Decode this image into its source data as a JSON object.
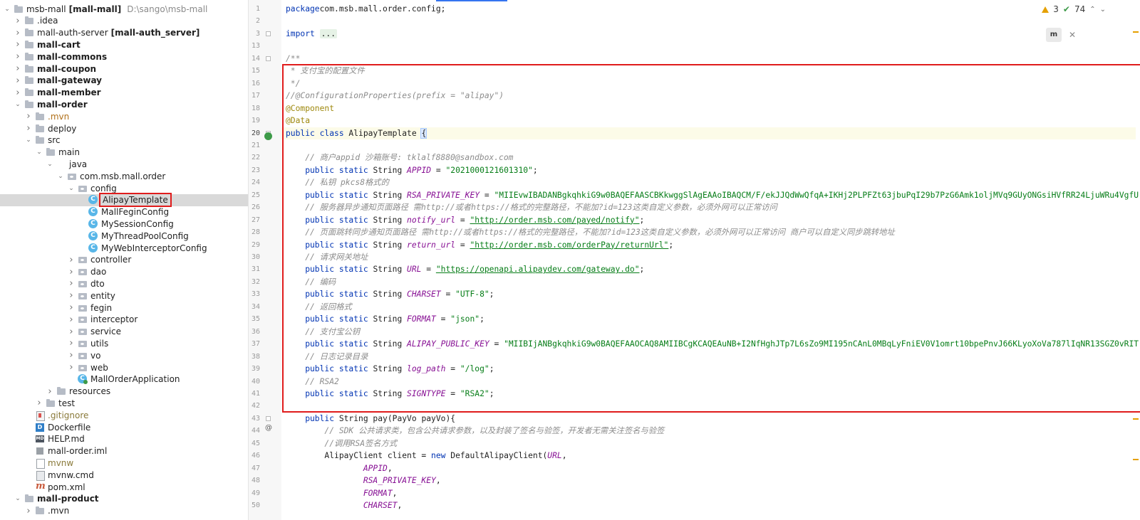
{
  "tree": {
    "rows": [
      {
        "label": "msb-mall",
        "extra": "[mall-mall]",
        "path": "D:\\sango\\msb-mall",
        "arrow": "down",
        "icon": "folder",
        "indent": 0,
        "bold": false
      },
      {
        "label": ".idea",
        "arrow": "right",
        "icon": "folder",
        "indent": 1
      },
      {
        "label": "mall-auth-server",
        "extra": "[mall-auth_server]",
        "arrow": "right",
        "icon": "folder",
        "indent": 1
      },
      {
        "label": "mall-cart",
        "arrow": "right",
        "icon": "folder",
        "indent": 1,
        "bold": true
      },
      {
        "label": "mall-commons",
        "arrow": "right",
        "icon": "folder",
        "indent": 1,
        "bold": true
      },
      {
        "label": "mall-coupon",
        "arrow": "right",
        "icon": "folder",
        "indent": 1,
        "bold": true
      },
      {
        "label": "mall-gateway",
        "arrow": "right",
        "icon": "folder",
        "indent": 1,
        "bold": true
      },
      {
        "label": "mall-member",
        "arrow": "right",
        "icon": "folder",
        "indent": 1,
        "bold": true
      },
      {
        "label": "mall-order",
        "arrow": "down",
        "icon": "folder",
        "indent": 1,
        "bold": true
      },
      {
        "label": ".mvn",
        "arrow": "right",
        "icon": "folder",
        "indent": 2,
        "style": "orange"
      },
      {
        "label": "deploy",
        "arrow": "right",
        "icon": "folder",
        "indent": 2
      },
      {
        "label": "src",
        "arrow": "down",
        "icon": "folder",
        "indent": 2
      },
      {
        "label": "main",
        "arrow": "down",
        "icon": "folder",
        "indent": 3
      },
      {
        "label": "java",
        "arrow": "down",
        "icon": "folder-blue",
        "indent": 4
      },
      {
        "label": "com.msb.mall.order",
        "arrow": "down",
        "icon": "pkg",
        "indent": 5
      },
      {
        "label": "config",
        "arrow": "down",
        "icon": "pkg",
        "indent": 6
      },
      {
        "label": "AlipayTemplate",
        "arrow": "none",
        "icon": "cls",
        "indent": 7,
        "selected": true,
        "boxed": true
      },
      {
        "label": "MallFeginConfig",
        "arrow": "none",
        "icon": "cls",
        "indent": 7
      },
      {
        "label": "MySessionConfig",
        "arrow": "none",
        "icon": "cls",
        "indent": 7
      },
      {
        "label": "MyThreadPoolConfig",
        "arrow": "none",
        "icon": "cls",
        "indent": 7
      },
      {
        "label": "MyWebInterceptorConfig",
        "arrow": "none",
        "icon": "cls",
        "indent": 7
      },
      {
        "label": "controller",
        "arrow": "right",
        "icon": "pkg",
        "indent": 6
      },
      {
        "label": "dao",
        "arrow": "right",
        "icon": "pkg",
        "indent": 6
      },
      {
        "label": "dto",
        "arrow": "right",
        "icon": "pkg",
        "indent": 6
      },
      {
        "label": "entity",
        "arrow": "right",
        "icon": "pkg",
        "indent": 6
      },
      {
        "label": "fegin",
        "arrow": "right",
        "icon": "pkg",
        "indent": 6
      },
      {
        "label": "interceptor",
        "arrow": "right",
        "icon": "pkg",
        "indent": 6
      },
      {
        "label": "service",
        "arrow": "right",
        "icon": "pkg",
        "indent": 6
      },
      {
        "label": "utils",
        "arrow": "right",
        "icon": "pkg",
        "indent": 6
      },
      {
        "label": "vo",
        "arrow": "right",
        "icon": "pkg",
        "indent": 6
      },
      {
        "label": "web",
        "arrow": "right",
        "icon": "pkg",
        "indent": 6
      },
      {
        "label": "MallOrderApplication",
        "arrow": "none",
        "icon": "app",
        "indent": 6
      },
      {
        "label": "resources",
        "arrow": "right",
        "icon": "folder",
        "indent": 4
      },
      {
        "label": "test",
        "arrow": "right",
        "icon": "folder",
        "indent": 3
      },
      {
        "label": ".gitignore",
        "arrow": "none",
        "icon": "git",
        "indent": 2,
        "style": "olive"
      },
      {
        "label": "Dockerfile",
        "arrow": "none",
        "icon": "docker",
        "indent": 2
      },
      {
        "label": "HELP.md",
        "arrow": "none",
        "icon": "md",
        "indent": 2
      },
      {
        "label": "mall-order.iml",
        "arrow": "none",
        "icon": "iml",
        "indent": 2
      },
      {
        "label": "mvnw",
        "arrow": "none",
        "icon": "sh",
        "indent": 2,
        "style": "olive"
      },
      {
        "label": "mvnw.cmd",
        "arrow": "none",
        "icon": "file",
        "indent": 2
      },
      {
        "label": "pom.xml",
        "arrow": "none",
        "icon": "maven",
        "indent": 2
      },
      {
        "label": "mall-product",
        "arrow": "down",
        "icon": "folder",
        "indent": 1,
        "bold": true
      },
      {
        "label": ".mvn",
        "arrow": "right",
        "icon": "folder",
        "indent": 2
      }
    ]
  },
  "editor": {
    "inspections": {
      "warnings": "3",
      "ok": "74"
    },
    "maven_popup": {
      "icon_label": "m"
    },
    "lines": [
      {
        "n": "1",
        "tokens": [
          [
            "kw",
            "package"
          ],
          [
            "",
            "com.msb.mall.order.config;"
          ]
        ]
      },
      {
        "n": "2",
        "tokens": []
      },
      {
        "n": "3",
        "tokens": [
          [
            "kw",
            "import "
          ],
          [
            "folded",
            "..."
          ]
        ]
      },
      {
        "n": "13",
        "tokens": []
      },
      {
        "n": "14",
        "tokens": [
          [
            "cm",
            "/**"
          ]
        ]
      },
      {
        "n": "15",
        "tokens": [
          [
            "cm",
            " * 支付宝的配置文件"
          ]
        ]
      },
      {
        "n": "16",
        "tokens": [
          [
            "cm",
            " */"
          ]
        ]
      },
      {
        "n": "17",
        "tokens": [
          [
            "cm",
            "//@ConfigurationProperties(prefix = \"alipay\")"
          ]
        ]
      },
      {
        "n": "18",
        "tokens": [
          [
            "ann",
            "@Component"
          ]
        ]
      },
      {
        "n": "19",
        "tokens": [
          [
            "ann",
            "@Data"
          ]
        ]
      },
      {
        "n": "20",
        "tokens": [
          [
            "kw",
            "public class "
          ],
          [
            "",
            "AlipayTemplate "
          ],
          [
            "brace",
            "{"
          ]
        ],
        "current": true
      },
      {
        "n": "21",
        "tokens": []
      },
      {
        "n": "22",
        "tokens": [
          [
            "cm",
            "    // 商户appid 沙箱账号: tklalf8880@sandbox.com"
          ]
        ]
      },
      {
        "n": "23",
        "tokens": [
          [
            "kw",
            "    public static "
          ],
          [
            "",
            "String "
          ],
          [
            "fld",
            "APPID"
          ],
          [
            "",
            " = "
          ],
          [
            "str",
            "\"2021000121601310\""
          ],
          [
            "",
            ";"
          ]
        ]
      },
      {
        "n": "24",
        "tokens": [
          [
            "cm",
            "    // 私钥 pkcs8格式的"
          ]
        ]
      },
      {
        "n": "25",
        "tokens": [
          [
            "kw",
            "    public static "
          ],
          [
            "",
            "String "
          ],
          [
            "fld",
            "RSA_PRIVATE_KEY"
          ],
          [
            "",
            " = "
          ],
          [
            "str",
            "\"MIIEvwIBADANBgkqhkiG9w0BAQEFAASCBKkwggSlAgEAAoIBAQCM/F/ekJJQdWwQfqA+IKHj2PLPFZt63jbuPqI29b7PzG6Amk1oljMVq9GUyONGsiHVfRR24LjuWRu4VgfU"
          ]
        ]
      },
      {
        "n": "26",
        "tokens": [
          [
            "cm",
            "    // 服务器异步通知页面路径 需http://或者https://格式的完整路径，不能加?id=123这类自定义参数，必须外网可以正常访问"
          ]
        ]
      },
      {
        "n": "27",
        "tokens": [
          [
            "kw",
            "    public static "
          ],
          [
            "",
            "String "
          ],
          [
            "fld",
            "notify_url"
          ],
          [
            "",
            " = "
          ],
          [
            "url",
            "\"http://order.msb.com/payed/notify\""
          ],
          [
            "",
            ";"
          ]
        ]
      },
      {
        "n": "28",
        "tokens": [
          [
            "cm",
            "    // 页面跳转同步通知页面路径 需http://或者https://格式的完整路径，不能加?id=123这类自定义参数，必须外网可以正常访问 商户可以自定义同步跳转地址"
          ]
        ]
      },
      {
        "n": "29",
        "tokens": [
          [
            "kw",
            "    public static "
          ],
          [
            "",
            "String "
          ],
          [
            "fld",
            "return_url"
          ],
          [
            "",
            " = "
          ],
          [
            "url",
            "\"http://order.msb.com/orderPay/returnUrl\""
          ],
          [
            "",
            ";"
          ]
        ]
      },
      {
        "n": "30",
        "tokens": [
          [
            "cm",
            "    // 请求网关地址"
          ]
        ]
      },
      {
        "n": "31",
        "tokens": [
          [
            "kw",
            "    public static "
          ],
          [
            "",
            "String "
          ],
          [
            "fld",
            "URL"
          ],
          [
            "",
            " = "
          ],
          [
            "url",
            "\"https://openapi.alipaydev.com/gateway.do\""
          ],
          [
            "",
            ";"
          ]
        ]
      },
      {
        "n": "32",
        "tokens": [
          [
            "cm",
            "    // 编码"
          ]
        ]
      },
      {
        "n": "33",
        "tokens": [
          [
            "kw",
            "    public static "
          ],
          [
            "",
            "String "
          ],
          [
            "fld",
            "CHARSET"
          ],
          [
            "",
            " = "
          ],
          [
            "str",
            "\"UTF-8\""
          ],
          [
            "",
            ";"
          ]
        ]
      },
      {
        "n": "34",
        "tokens": [
          [
            "cm",
            "    // 返回格式"
          ]
        ]
      },
      {
        "n": "35",
        "tokens": [
          [
            "kw",
            "    public static "
          ],
          [
            "",
            "String "
          ],
          [
            "fld",
            "FORMAT"
          ],
          [
            "",
            " = "
          ],
          [
            "str",
            "\"json\""
          ],
          [
            "",
            ";"
          ]
        ]
      },
      {
        "n": "36",
        "tokens": [
          [
            "cm",
            "    // 支付宝公钥"
          ]
        ]
      },
      {
        "n": "37",
        "tokens": [
          [
            "kw",
            "    public static "
          ],
          [
            "",
            "String "
          ],
          [
            "fld",
            "ALIPAY_PUBLIC_KEY"
          ],
          [
            "",
            " = "
          ],
          [
            "str",
            "\"MIIBIjANBgkqhkiG9w0BAQEFAAOCAQ8AMIIBCgKCAQEAuNB+I2NfHghJTp7L6sZo9MI195nCAnL0MBqLyFniEV0V1omrt10bpePnvJ66KLyoXoVa787lIqNR13SGZ0vRIT"
          ]
        ]
      },
      {
        "n": "38",
        "tokens": [
          [
            "cm",
            "    // 日志记录目录"
          ]
        ]
      },
      {
        "n": "39",
        "tokens": [
          [
            "kw",
            "    public static "
          ],
          [
            "",
            "String "
          ],
          [
            "fld",
            "log_path"
          ],
          [
            "",
            " = "
          ],
          [
            "str",
            "\"/log\""
          ],
          [
            "",
            ";"
          ]
        ]
      },
      {
        "n": "40",
        "tokens": [
          [
            "cm",
            "    // RSA2"
          ]
        ]
      },
      {
        "n": "41",
        "tokens": [
          [
            "kw",
            "    public static "
          ],
          [
            "",
            "String "
          ],
          [
            "fld",
            "SIGNTYPE"
          ],
          [
            "",
            " = "
          ],
          [
            "str",
            "\"RSA2\""
          ],
          [
            "",
            ";"
          ]
        ]
      },
      {
        "n": "42",
        "tokens": []
      },
      {
        "n": "43",
        "tokens": [
          [
            "kw",
            "    public "
          ],
          [
            "",
            "String pay(PayVo payVo){"
          ]
        ]
      },
      {
        "n": "44",
        "tokens": [
          [
            "cm",
            "        // SDK 公共请求类，包含公共请求参数，以及封装了签名与验签，开发者无需关注签名与验签"
          ]
        ]
      },
      {
        "n": "45",
        "tokens": [
          [
            "cm",
            "        //调用RSA签名方式"
          ]
        ]
      },
      {
        "n": "46",
        "tokens": [
          [
            "",
            "        AlipayClient client = "
          ],
          [
            "kw",
            "new "
          ],
          [
            "",
            "DefaultAlipayClient("
          ],
          [
            "fld",
            "URL"
          ],
          [
            "",
            ","
          ]
        ]
      },
      {
        "n": "47",
        "tokens": [
          [
            "fld",
            "                APPID"
          ],
          [
            "",
            ","
          ]
        ]
      },
      {
        "n": "48",
        "tokens": [
          [
            "fld",
            "                RSA_PRIVATE_KEY"
          ],
          [
            "",
            ","
          ]
        ]
      },
      {
        "n": "49",
        "tokens": [
          [
            "fld",
            "                FORMAT"
          ],
          [
            "",
            ","
          ]
        ]
      },
      {
        "n": "50",
        "tokens": [
          [
            "fld",
            "                CHARSET"
          ],
          [
            "",
            ","
          ]
        ]
      }
    ]
  }
}
